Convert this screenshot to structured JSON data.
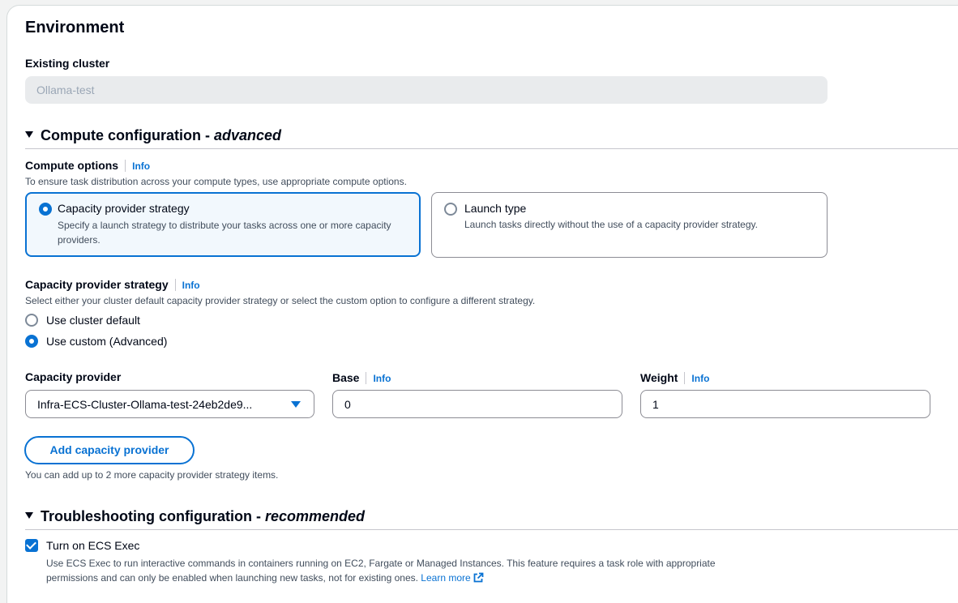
{
  "environment": {
    "title": "Environment",
    "existing_cluster_label": "Existing cluster",
    "existing_cluster_value": "Ollama-test"
  },
  "compute": {
    "heading": "Compute configuration - ",
    "heading_em": "advanced",
    "options_label": "Compute options",
    "info": "Info",
    "options_desc": "To ensure task distribution across your compute types, use appropriate compute options.",
    "tiles": [
      {
        "title": "Capacity provider strategy",
        "desc": "Specify a launch strategy to distribute your tasks across one or more capacity providers.",
        "selected": true
      },
      {
        "title": "Launch type",
        "desc": "Launch tasks directly without the use of a capacity provider strategy.",
        "selected": false
      }
    ],
    "strategy_label": "Capacity provider strategy",
    "strategy_desc": "Select either your cluster default capacity provider strategy or select the custom option to configure a different strategy.",
    "strategy_options": [
      {
        "label": "Use cluster default",
        "selected": false
      },
      {
        "label": "Use custom (Advanced)",
        "selected": true
      }
    ],
    "provider_label": "Capacity provider",
    "provider_value": "Infra-ECS-Cluster-Ollama-test-24eb2de9...",
    "base_label": "Base",
    "base_value": "0",
    "weight_label": "Weight",
    "weight_value": "1",
    "add_button": "Add capacity provider",
    "add_hint": "You can add up to 2 more capacity provider strategy items."
  },
  "troubleshooting": {
    "heading": "Troubleshooting configuration - ",
    "heading_em": "recommended",
    "ecs_exec_label": "Turn on ECS Exec",
    "ecs_exec_checked": true,
    "ecs_exec_desc_1": "Use ECS Exec to run interactive commands in containers running on EC2, Fargate or Managed Instances. This feature requires a task role with appropriate",
    "ecs_exec_desc_2": "permissions and can only be enabled when launching new tasks, not for existing ones.",
    "learn_more": "Learn more"
  },
  "colors": {
    "accent": "#0972d3",
    "text": "#000716",
    "muted": "#414d5c",
    "disabled_bg": "#e9ebed"
  }
}
